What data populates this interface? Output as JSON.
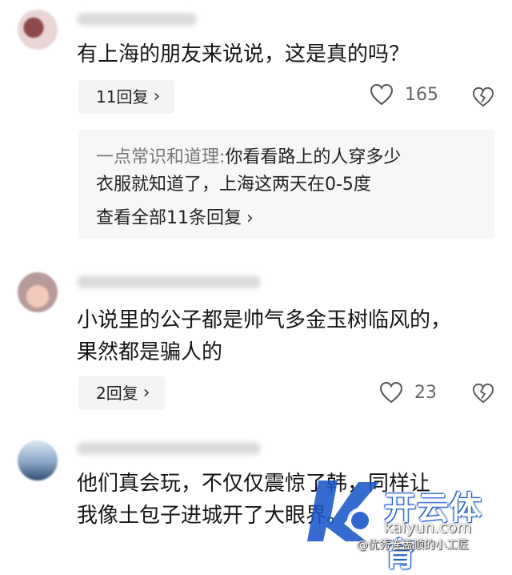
{
  "comments": [
    {
      "text_lines": [
        "有上海的朋友来说说，这是真的吗？"
      ],
      "reply_count_label": "11回复",
      "likes": "165",
      "featured_reply": {
        "author": "一点常识和道理:",
        "text_line1": "你看看路上的人穿多少",
        "text_line2": "衣服就知道了，上海这两天在0-5度",
        "view_all_label": "查看全部11条回复"
      }
    },
    {
      "text_lines": [
        "小说里的公子都是帅气多金玉树临风的，",
        "果然都是骗人的"
      ],
      "reply_count_label": "2回复",
      "likes": "23"
    },
    {
      "text_lines": [
        "他们真会玩，不仅仅震惊了韩，同样让",
        "我像土包子进城开了大眼界。"
      ]
    }
  ],
  "watermark": {
    "brand": "开云体育",
    "site": "kaiyun.com",
    "credit": "@优秀连盖顺的小工匠",
    "accent_color": "#1a57c8"
  },
  "icons": [
    "heart-icon",
    "broken-heart-icon",
    "chevron-right-icon"
  ]
}
